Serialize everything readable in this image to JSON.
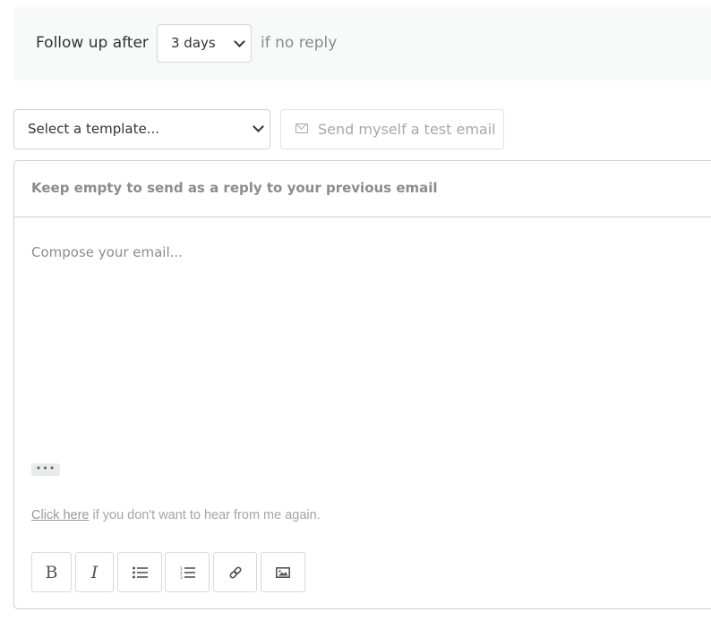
{
  "followup": {
    "label": "Follow up after",
    "delay_selected": "3 days",
    "suffix": "if no reply"
  },
  "template": {
    "selected": "Select a template..."
  },
  "test_email": {
    "label": "Send myself a test email",
    "icon": "envelope-icon"
  },
  "editor": {
    "subject_placeholder": "Keep empty to send as a reply to your previous email",
    "body_placeholder": "Compose your email...",
    "more_label": "•••",
    "unsubscribe": {
      "link_text": "Click here",
      "rest_text": " if you don't want to hear from me again."
    },
    "toolbar": [
      {
        "name": "bold",
        "glyph": "B"
      },
      {
        "name": "italic",
        "glyph": "I"
      },
      {
        "name": "bullet-list",
        "icon": "bullet-list-icon"
      },
      {
        "name": "numbered-list",
        "icon": "numbered-list-icon"
      },
      {
        "name": "link",
        "icon": "link-icon"
      },
      {
        "name": "image",
        "icon": "image-icon"
      }
    ]
  }
}
